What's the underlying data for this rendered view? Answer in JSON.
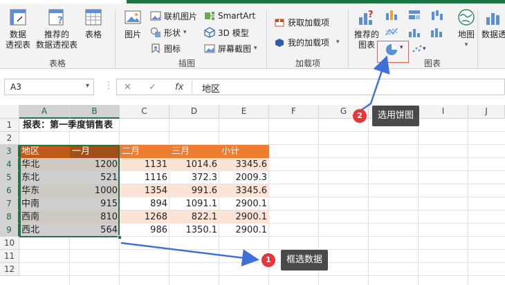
{
  "ribbon": {
    "groups": [
      {
        "label": "表格"
      },
      {
        "label": "插图"
      },
      {
        "label": "加载项"
      },
      {
        "label": "图表"
      }
    ],
    "pivot_label_1": "数据",
    "pivot_label_2": "透视表",
    "rec_pivot_label_1": "推荐的",
    "rec_pivot_label_2": "数据透视表",
    "table_label": "表格",
    "picture_label": "图片",
    "online_pic_label": "联机图片",
    "shapes_label": "形状",
    "icons_label": "图标",
    "smartart_label": "SmartArt",
    "model3d_label": "3D 模型",
    "screenshot_label": "屏幕截图",
    "get_addins_label": "获取加载项",
    "my_addins_label": "我的加载项",
    "rec_charts_label_1": "推荐的",
    "rec_charts_label_2": "图表",
    "map_label": "地图",
    "pivotchart_label": "数据透"
  },
  "formula_bar": {
    "name_box": "A3",
    "cancel": "✕",
    "enter": "✓",
    "fx": "fx",
    "value": "地区"
  },
  "columns": [
    "A",
    "B",
    "C",
    "D",
    "E",
    "F",
    "G",
    "H",
    "I",
    "J"
  ],
  "rows": [
    "1",
    "2",
    "3",
    "4",
    "5",
    "6",
    "7",
    "8",
    "9",
    "10",
    "11",
    "12"
  ],
  "sheet": {
    "title": "报表：第一季度销售表",
    "headers": [
      "地区",
      "一月",
      "二月",
      "三月",
      "小计"
    ],
    "data": [
      [
        "华北",
        "1200",
        "1131",
        "1014.6",
        "3345.6"
      ],
      [
        "东北",
        "521",
        "1116",
        "372.3",
        "2009.3"
      ],
      [
        "华东",
        "1000",
        "1354",
        "991.6",
        "3345.6"
      ],
      [
        "中南",
        "915",
        "894",
        "1091.1",
        "2900.1"
      ],
      [
        "西南",
        "810",
        "1268",
        "822.1",
        "2900.1"
      ],
      [
        "西北",
        "564",
        "986",
        "1350.1",
        "2900.1"
      ]
    ]
  },
  "annotations": {
    "step1_num": "1",
    "step1_text": "框选数据",
    "step2_num": "2",
    "step2_text": "选用饼图"
  },
  "colors": {
    "header_orange": "#ed7d31",
    "band_light": "#fbe4d5",
    "selection_green": "#217346",
    "callout_bg": "#4a4a4a",
    "badge_red": "#e23a3a",
    "arrow_blue": "#3f6fd8"
  }
}
